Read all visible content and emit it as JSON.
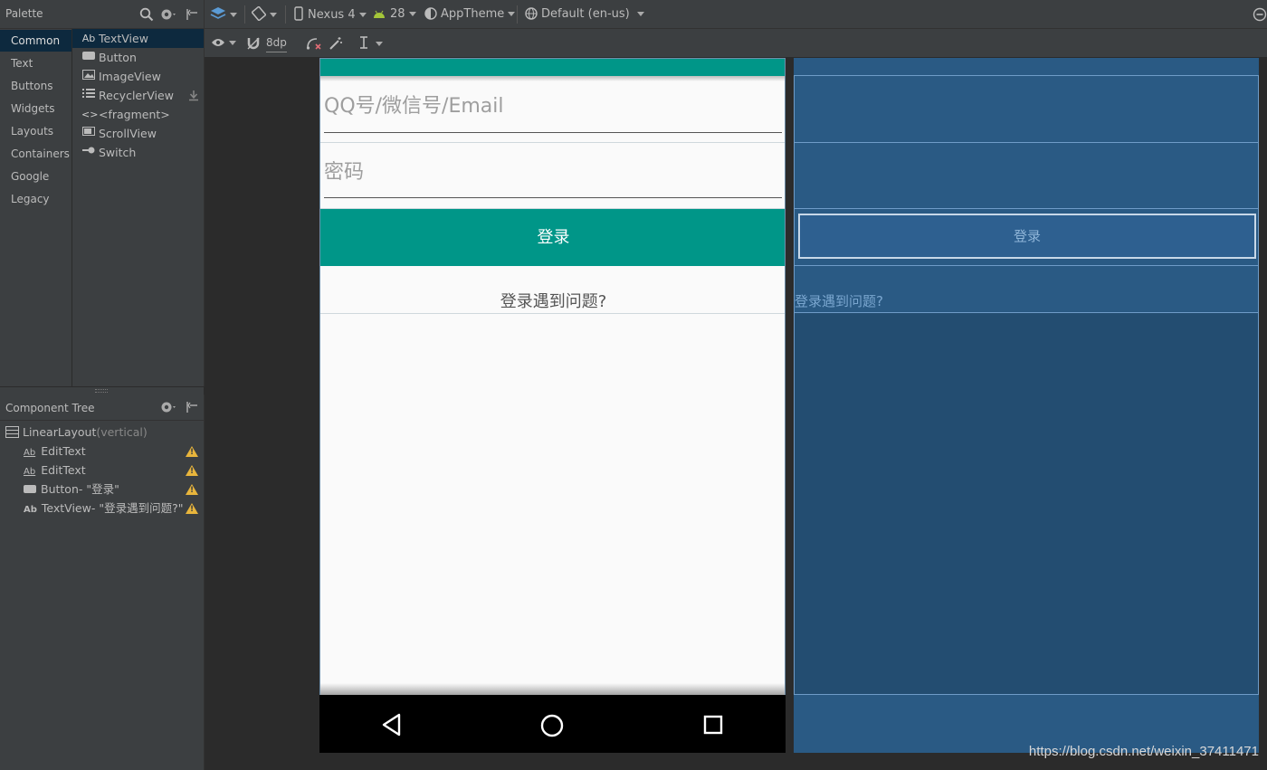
{
  "palette": {
    "title": "Palette",
    "categories": [
      "Common",
      "Text",
      "Buttons",
      "Widgets",
      "Layouts",
      "Containers",
      "Google",
      "Legacy"
    ],
    "items": [
      {
        "icon": "Ab",
        "label": "TextView"
      },
      {
        "icon": "button-icon",
        "label": "Button"
      },
      {
        "icon": "image-icon",
        "label": "ImageView"
      },
      {
        "icon": "list-icon",
        "label": "RecyclerView"
      },
      {
        "icon": "<>",
        "label": "<fragment>"
      },
      {
        "icon": "scroll-icon",
        "label": "ScrollView"
      },
      {
        "icon": "switch-icon",
        "label": "Switch"
      }
    ]
  },
  "toolbar": {
    "device": "Nexus 4",
    "api": "28",
    "theme": "AppTheme",
    "locale": "Default (en-us)",
    "margin": "8dp"
  },
  "component_tree": {
    "title": "Component Tree",
    "root": "LinearLayout",
    "root_suffix": "(vertical)",
    "children": [
      {
        "icon": "Ab",
        "label": "EditText"
      },
      {
        "icon": "Ab",
        "label": "EditText"
      },
      {
        "icon": "button-icon",
        "label": "Button- \"登录\""
      },
      {
        "icon": "Ab",
        "label": "TextView- \"登录遇到问题?\""
      }
    ]
  },
  "preview": {
    "account_hint": "QQ号/微信号/Email",
    "password_hint": "密码",
    "login_button": "登录",
    "trouble_text": "登录遇到问题?"
  },
  "blueprint": {
    "login_button": "登录",
    "trouble_text": "登录遇到问题?"
  },
  "watermark": "https://blog.csdn.net/weixin_37411471",
  "colors": {
    "accent": "#009688",
    "ide_bg": "#2b2b2b",
    "panel_bg": "#3c3f41",
    "blueprint_bg": "#2c5a83"
  }
}
